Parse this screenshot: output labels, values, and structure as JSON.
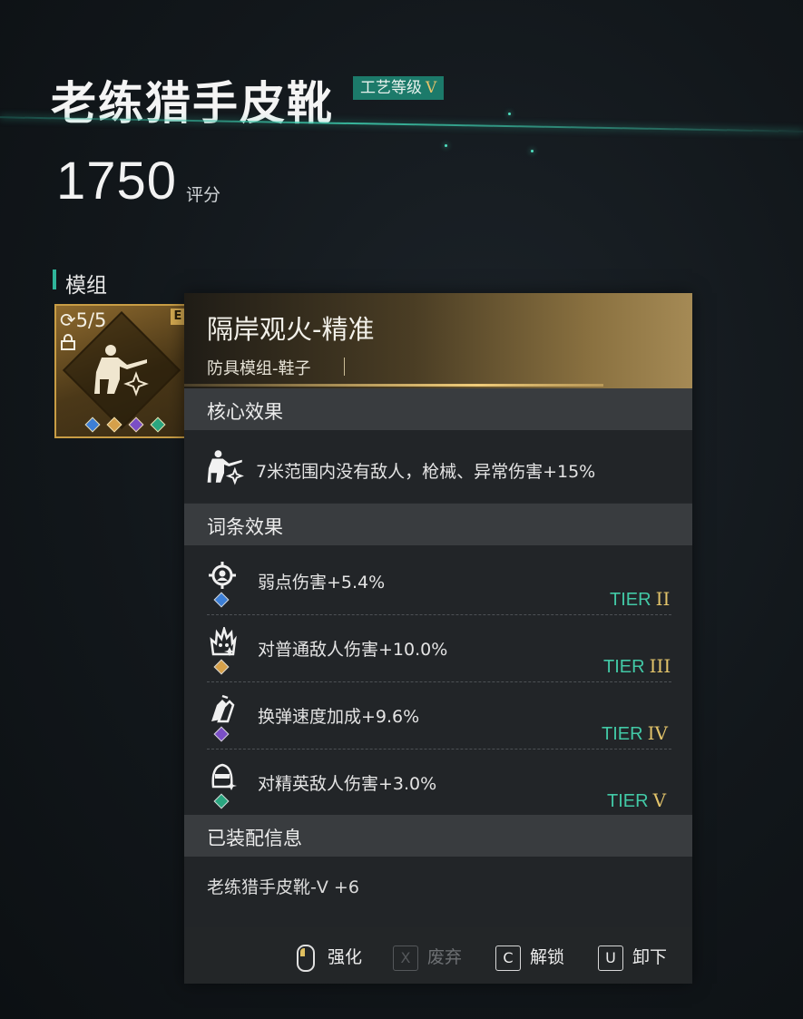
{
  "item": {
    "name": "老练猎手皮靴",
    "badge_label": "工艺等级",
    "badge_tier": "V",
    "score": "1750",
    "score_unit": "评分"
  },
  "section_label": "模组",
  "module_card": {
    "count": "5/5",
    "corner_tag": "E",
    "gems": [
      "#3d7fd6",
      "#d6a04a",
      "#7b4fc6",
      "#2aa680"
    ]
  },
  "tooltip": {
    "title": "隔岸观火-精准",
    "subtitle": "防具模组-鞋子",
    "core_header": "核心效果",
    "core_effect": "7米范围内没有敌人，枪械、异常伤害+15%",
    "affix_header": "词条效果",
    "affixes": [
      {
        "text": "弱点伤害+5.4%",
        "tier_label": "TIER",
        "tier": "II",
        "icon": "crosshair-icon",
        "gem_color": "#3d7fd6"
      },
      {
        "text": "对普通敌人伤害+10.0%",
        "tier_label": "TIER",
        "tier": "III",
        "icon": "flame-face-icon",
        "gem_color": "#d6a04a"
      },
      {
        "text": "换弹速度加成+9.6%",
        "tier_label": "TIER",
        "tier": "IV",
        "icon": "ammo-icon",
        "gem_color": "#7b4fc6"
      },
      {
        "text": "对精英敌人伤害+3.0%",
        "tier_label": "TIER",
        "tier": "V",
        "icon": "elite-mask-icon",
        "gem_color": "#2aa680"
      }
    ],
    "equipped_header": "已装配信息",
    "equipped_text": "老练猎手皮靴-V +6"
  },
  "footer": {
    "enhance": "强化",
    "discard_key": "X",
    "discard": "废弃",
    "unlock_key": "C",
    "unlock": "解锁",
    "unequip_key": "U",
    "unequip": "卸下"
  }
}
